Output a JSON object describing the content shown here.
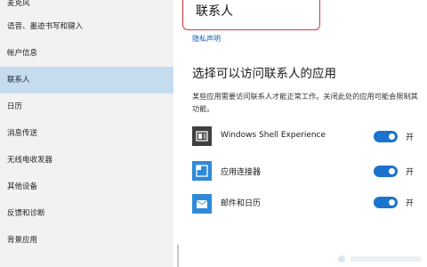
{
  "sidebar": {
    "items": [
      {
        "label": "麦克风"
      },
      {
        "label": "语音、墨迹书写和键入"
      },
      {
        "label": "帐户信息"
      },
      {
        "label": "联系人"
      },
      {
        "label": "日历"
      },
      {
        "label": "消息传送"
      },
      {
        "label": "无线电收发器"
      },
      {
        "label": "其他设备"
      },
      {
        "label": "反馈和诊断"
      },
      {
        "label": "背景应用"
      }
    ],
    "selected_index": 3
  },
  "main": {
    "title": "联系人",
    "privacy_link": "隐私声明",
    "section_heading": "选择可以访问联系人的应用",
    "description": "某些应用需要访问联系人才能正常工作。关闭此处的应用可能会限制其功能。",
    "apps": [
      {
        "name": "Windows Shell Experience",
        "toggle_on": true,
        "toggle_label": "开",
        "icon": "windows-shell-icon"
      },
      {
        "name": "应用连接器",
        "toggle_on": true,
        "toggle_label": "开",
        "icon": "app-connector-icon"
      },
      {
        "name": "邮件和日历",
        "toggle_on": true,
        "toggle_label": "开",
        "icon": "mail-icon"
      }
    ]
  },
  "colors": {
    "accent": "#1a73cc",
    "selected_nav": "#c5dcef",
    "highlight_border": "#d9363e",
    "link": "#1a5fb4"
  }
}
